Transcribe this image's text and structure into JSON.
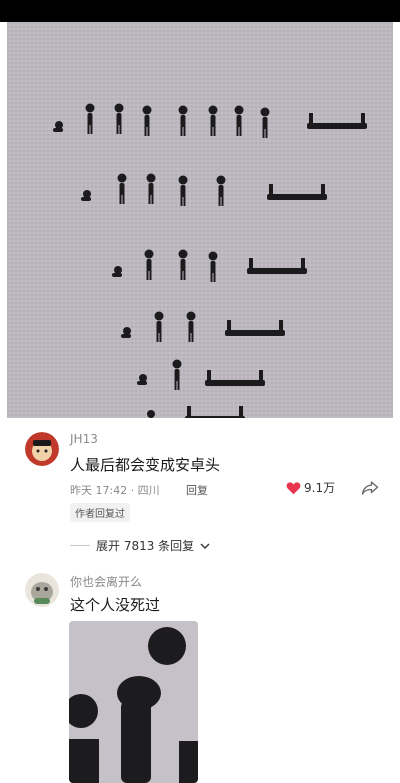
{
  "comments": [
    {
      "username": "JH13",
      "text": "人最后都会变成安卓头",
      "time_location": "昨天 17:42 · 四川",
      "reply_label": "回复",
      "likes": "9.1万",
      "badge": "作者回复过",
      "expand_label": "展开 7813 条回复"
    },
    {
      "username": "你也会离开么",
      "text": "这个人没死过"
    }
  ],
  "colors": {
    "like": "#e8344e",
    "accent_text": "#1a1a1a",
    "muted": "#8a8a8a"
  },
  "icons": [
    "heart-icon",
    "share-icon",
    "chevron-down-icon"
  ]
}
